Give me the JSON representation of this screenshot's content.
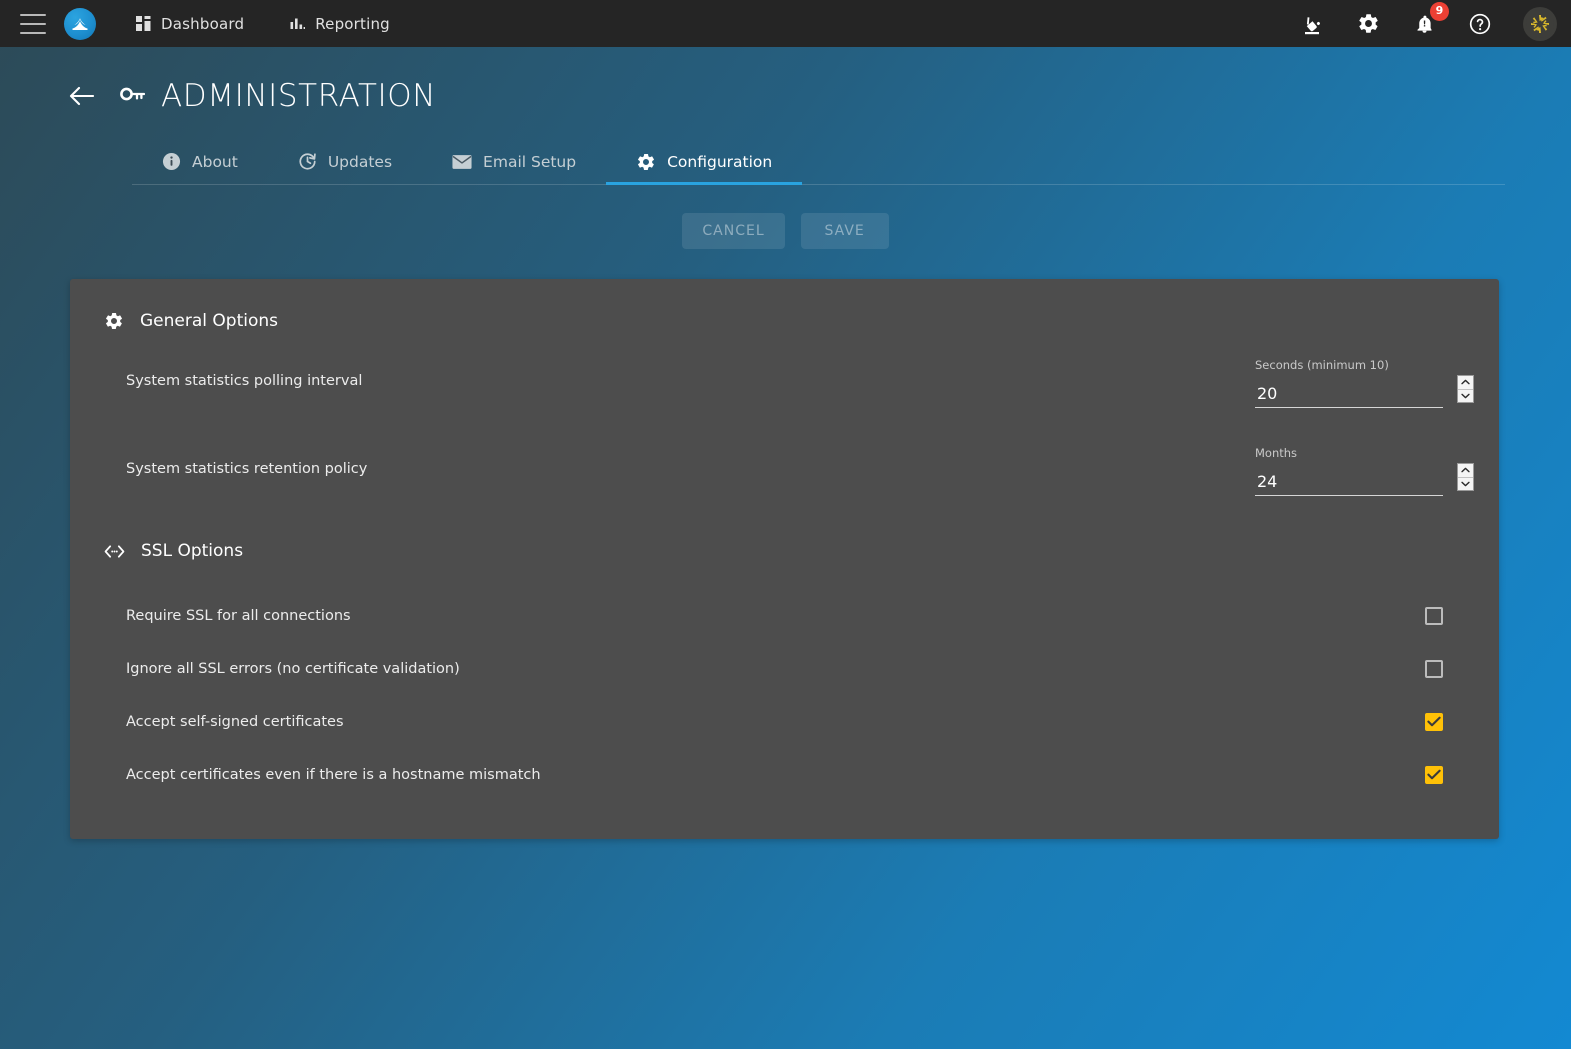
{
  "topbar": {
    "menu_icon": "hamburger-icon",
    "logo_icon": "app-logo-icon",
    "nav": [
      {
        "label": "Dashboard",
        "icon": "dashboard-grid-icon"
      },
      {
        "label": "Reporting",
        "icon": "bar-chart-icon"
      }
    ],
    "right_icons": [
      {
        "name": "theme-paint-icon"
      },
      {
        "name": "gear-icon"
      },
      {
        "name": "notifications-bell-icon"
      },
      {
        "name": "help-circle-icon"
      }
    ],
    "notification_count": "9",
    "avatar_icon": "user-avatar-identicon"
  },
  "header": {
    "back_icon": "back-arrow-icon",
    "title_icon": "key-icon",
    "title": "ADMINISTRATION"
  },
  "tabs": [
    {
      "label": "About",
      "icon": "info-circle-icon",
      "active": false
    },
    {
      "label": "Updates",
      "icon": "refresh-clock-icon",
      "active": false
    },
    {
      "label": "Email Setup",
      "icon": "envelope-icon",
      "active": false
    },
    {
      "label": "Configuration",
      "icon": "gear-icon",
      "active": true
    }
  ],
  "actions": {
    "cancel_label": "CANCEL",
    "save_label": "SAVE"
  },
  "general_options": {
    "icon": "gear-icon",
    "title": "General Options",
    "fields": [
      {
        "label": "System statistics polling interval",
        "field_label": "Seconds (minimum 10)",
        "value": "20"
      },
      {
        "label": "System statistics retention policy",
        "field_label": "Months",
        "value": "24"
      }
    ]
  },
  "ssl_options": {
    "icon": "code-brackets-icon",
    "title": "SSL Options",
    "items": [
      {
        "label": "Require SSL for all connections",
        "checked": false
      },
      {
        "label": "Ignore all SSL errors (no certificate validation)",
        "checked": false
      },
      {
        "label": "Accept self-signed certificates",
        "checked": true
      },
      {
        "label": "Accept certificates even if there is a hostname mismatch",
        "checked": true
      }
    ]
  },
  "colors": {
    "accent_blue": "#29a3e0",
    "checkbox_on": "#ffc107",
    "badge_red": "#ec4034",
    "panel_bg": "#4d4d4d",
    "topbar_bg": "#252525"
  }
}
